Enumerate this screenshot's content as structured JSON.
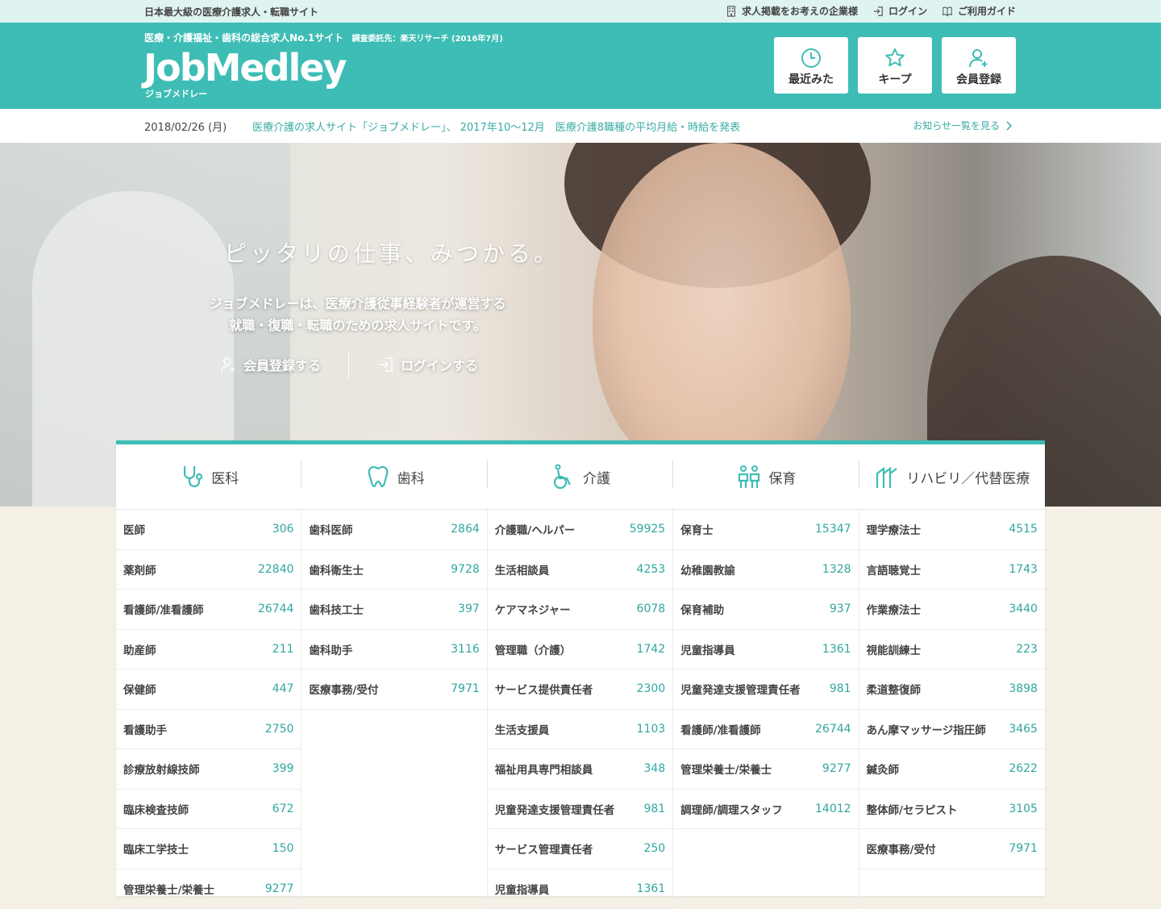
{
  "topbar": {
    "tagline": "日本最大級の医療介護求人・転職サイト",
    "links": [
      {
        "label": "求人掲載をお考えの企業様",
        "icon": "building-icon"
      },
      {
        "label": "ログイン",
        "icon": "login-icon"
      },
      {
        "label": "ご利用ガイド",
        "icon": "book-icon"
      }
    ]
  },
  "header": {
    "subtitle": "医療・介護福祉・歯科の総合求人No.1サイト",
    "survey": "調査委託先：楽天リサーチ (2016年7月)",
    "logo_word": "JobMedley",
    "logo_kana": "ジョブメドレー",
    "buttons": [
      {
        "label": "最近みた",
        "icon": "clock-icon"
      },
      {
        "label": "キープ",
        "icon": "star-icon"
      },
      {
        "label": "会員登録",
        "icon": "user-add-icon"
      }
    ]
  },
  "news": {
    "date": "2018/02/26 (月)",
    "headline": "医療介護の求人サイト「ジョブメドレー」、 2017年10〜12月　医療介護8職種の平均月給・時給を発表",
    "more": "お知らせ一覧を見る"
  },
  "hero": {
    "catch": "ピッタリの仕事、みつかる。",
    "desc_line1": "ジョブメドレーは、医療介護従事経験者が運営する",
    "desc_line2": "就職・復職・転職のための求人サイトです。",
    "register": "会員登録する",
    "login": "ログインする"
  },
  "categories": [
    {
      "label": "医科",
      "icon": "stethoscope-icon",
      "jobs": [
        [
          "医師",
          "306"
        ],
        [
          "薬剤師",
          "22840"
        ],
        [
          "看護師/准看護師",
          "26744"
        ],
        [
          "助産師",
          "211"
        ],
        [
          "保健師",
          "447"
        ],
        [
          "看護助手",
          "2750"
        ],
        [
          "診療放射線技師",
          "399"
        ],
        [
          "臨床検査技師",
          "672"
        ],
        [
          "臨床工学技士",
          "150"
        ],
        [
          "管理栄養士/栄養士",
          "9277"
        ]
      ]
    },
    {
      "label": "歯科",
      "icon": "tooth-icon",
      "jobs": [
        [
          "歯科医師",
          "2864"
        ],
        [
          "歯科衛生士",
          "9728"
        ],
        [
          "歯科技工士",
          "397"
        ],
        [
          "歯科助手",
          "3116"
        ],
        [
          "医療事務/受付",
          "7971"
        ]
      ]
    },
    {
      "label": "介護",
      "icon": "wheelchair-icon",
      "jobs": [
        [
          "介護職/ヘルパー",
          "59925"
        ],
        [
          "生活相談員",
          "4253"
        ],
        [
          "ケアマネジャー",
          "6078"
        ],
        [
          "管理職（介護）",
          "1742"
        ],
        [
          "サービス提供責任者",
          "2300"
        ],
        [
          "生活支援員",
          "1103"
        ],
        [
          "福祉用具専門相談員",
          "348"
        ],
        [
          "児童発達支援管理責任者",
          "981"
        ],
        [
          "サービス管理責任者",
          "250"
        ],
        [
          "児童指導員",
          "1361"
        ]
      ]
    },
    {
      "label": "保育",
      "icon": "children-icon",
      "jobs": [
        [
          "保育士",
          "15347"
        ],
        [
          "幼稚園教諭",
          "1328"
        ],
        [
          "保育補助",
          "937"
        ],
        [
          "児童指導員",
          "1361"
        ],
        [
          "児童発達支援管理責任者",
          "981"
        ],
        [
          "看護師/准看護師",
          "26744"
        ],
        [
          "管理栄養士/栄養士",
          "9277"
        ],
        [
          "調理師/調理スタッフ",
          "14012"
        ]
      ]
    },
    {
      "label": "リハビリ／代替医療",
      "icon": "rehab-icon",
      "jobs": [
        [
          "理学療法士",
          "4515"
        ],
        [
          "言語聴覚士",
          "1743"
        ],
        [
          "作業療法士",
          "3440"
        ],
        [
          "視能訓練士",
          "223"
        ],
        [
          "柔道整復師",
          "3898"
        ],
        [
          "あん摩マッサージ指圧師",
          "3465"
        ],
        [
          "鍼灸師",
          "2622"
        ],
        [
          "整体師/セラピスト",
          "3105"
        ],
        [
          "医療事務/受付",
          "7971"
        ]
      ]
    }
  ],
  "colors": {
    "accent": "#3dbdb5",
    "topbar_bg": "#dff3f1",
    "count": "#2fa79f"
  }
}
